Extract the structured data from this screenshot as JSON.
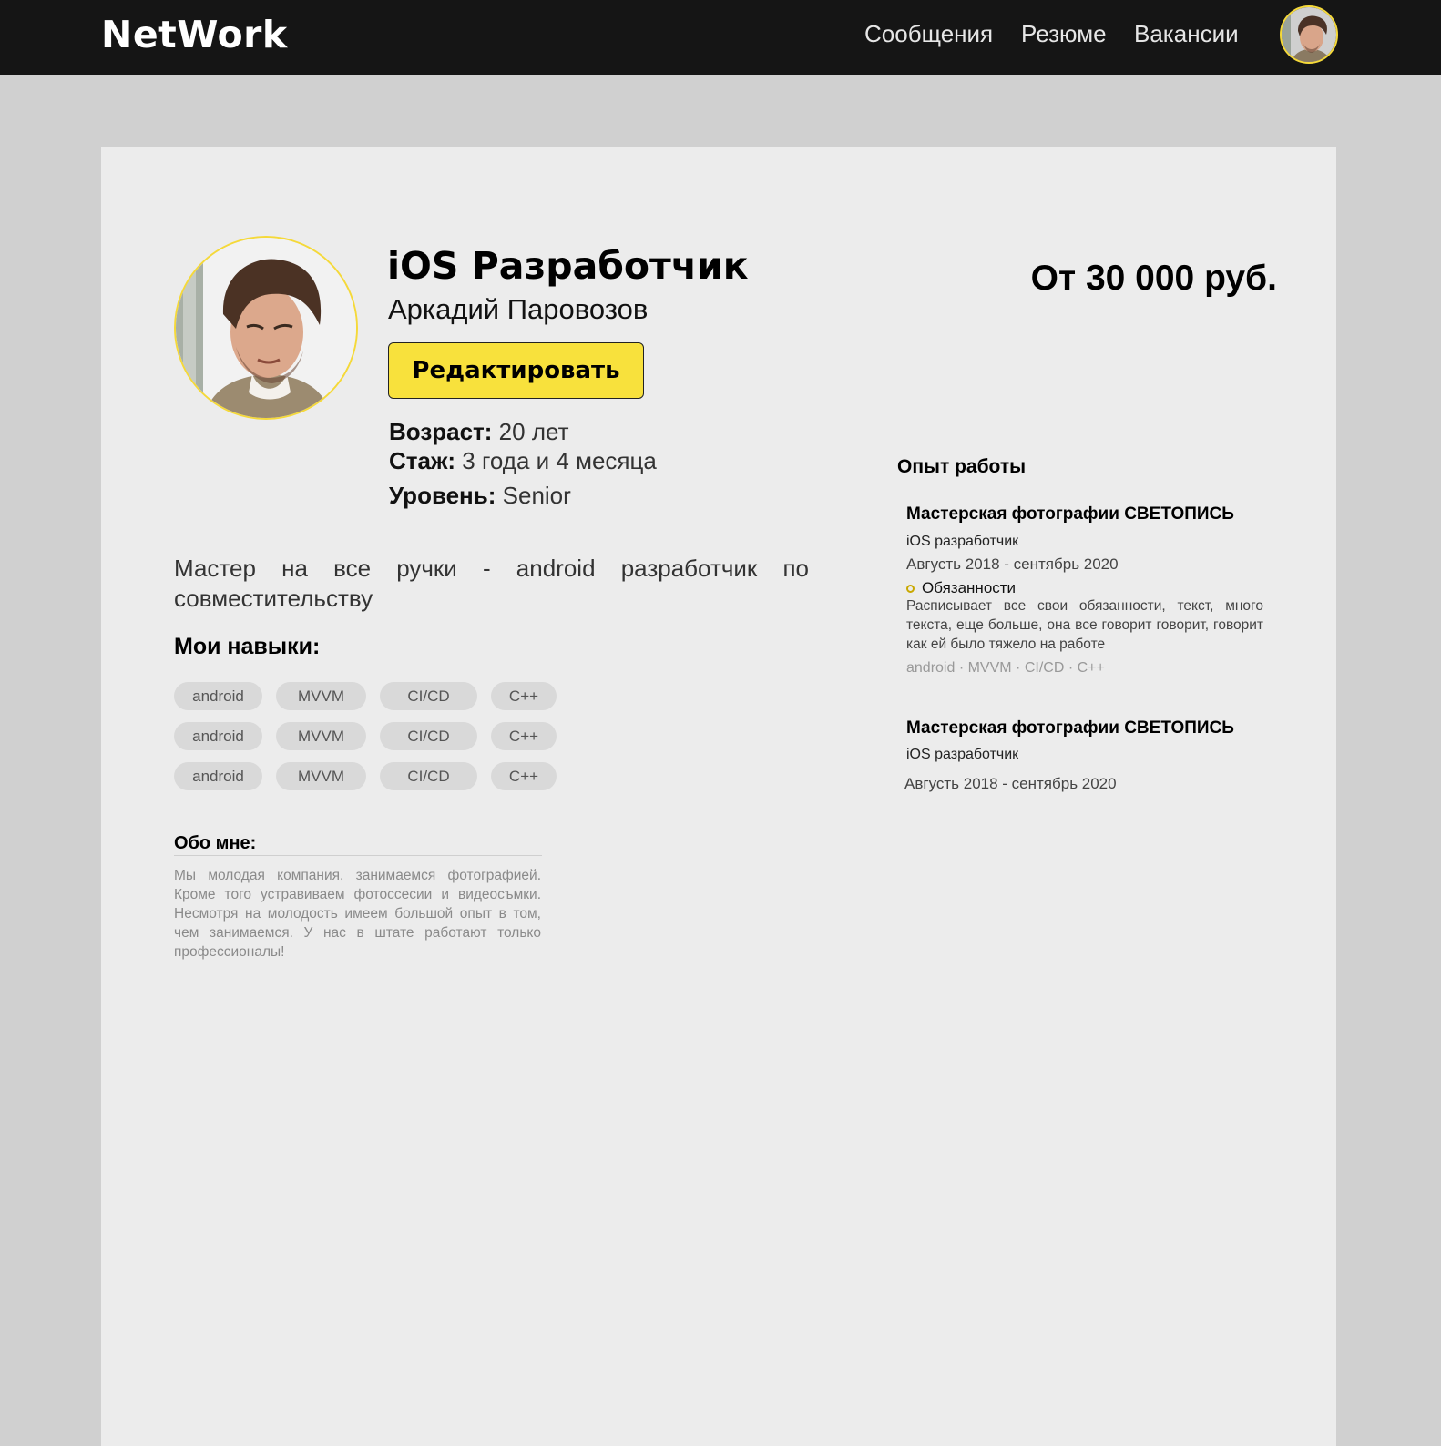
{
  "header": {
    "logo": "NetWork",
    "nav": [
      "Сообщения",
      "Резюме",
      "Вакансии"
    ]
  },
  "profile": {
    "title": "iOS Разработчик",
    "name": "Аркадий Паровозов",
    "edit_label": "Редактировать",
    "salary": "От 30 000 руб.",
    "age_label": "Возраст:",
    "age_value": "20 лет",
    "experience_label": "Стаж:",
    "experience_value": "3 года и 4 месяца",
    "level_label": "Уровень:",
    "level_value": "Senior",
    "motto": "Мастер на все ручки - android разработчик по совместительству"
  },
  "skills": {
    "title": "Мои навыки:",
    "items": [
      "android",
      "MVVM",
      "CI/CD",
      "C++",
      "android",
      "MVVM",
      "CI/CD",
      "C++",
      "android",
      "MVVM",
      "CI/CD",
      "C++"
    ]
  },
  "about": {
    "title": "Обо мне:",
    "text": "Мы молодая компания, занимаемся фотографией. Кроме того устравиваем фотоссесии и видеосъмки. Несмотря на молодость имеем большой опыт в том, чем занимаемся. У нас в штате работают только профессионалы!"
  },
  "experience": {
    "title": "Опыт работы",
    "jobs": [
      {
        "company": "Мастерская фотографии СВЕТОПИСЬ",
        "role": "iOS разработчик",
        "dates": "Августь 2018 - сентябрь 2020",
        "duties_label": "Обязанности",
        "duties_text": "Расписывает все свои обязанности, текст, много текста, еще больше, она все говорит говорит, говорит как ей было тяжело на работе",
        "tags": "android · MVVM · CI/CD  · C++"
      },
      {
        "company": "Мастерская фотографии СВЕТОПИСЬ",
        "role": "iOS разработчик",
        "dates": "Августь 2018 - сентябрь 2020"
      }
    ]
  },
  "colors": {
    "accent": "#f8e13c",
    "header_bg": "#151515",
    "page_bg": "#d0d0d0",
    "card_bg": "#ececec"
  }
}
